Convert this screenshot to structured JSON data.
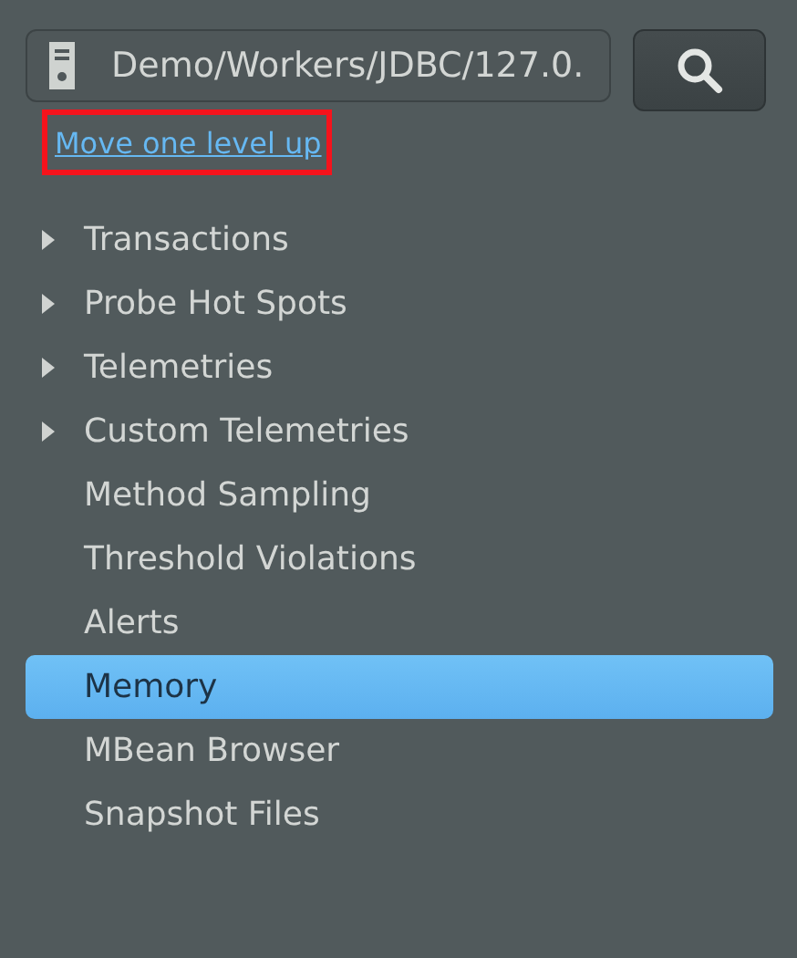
{
  "path_field": {
    "value": "Demo/Workers/JDBC/127.0."
  },
  "up_link": {
    "label": "Move one level up",
    "highlighted": true
  },
  "tree": [
    {
      "label": "Transactions",
      "kind": "branch",
      "expanded": false,
      "selected": false
    },
    {
      "label": "Probe Hot Spots",
      "kind": "branch",
      "expanded": false,
      "selected": false
    },
    {
      "label": "Telemetries",
      "kind": "branch",
      "expanded": false,
      "selected": false
    },
    {
      "label": "Custom Telemetries",
      "kind": "branch",
      "expanded": false,
      "selected": false
    },
    {
      "label": "Method Sampling",
      "kind": "leaf",
      "selected": false
    },
    {
      "label": "Threshold Violations",
      "kind": "leaf",
      "selected": false
    },
    {
      "label": "Alerts",
      "kind": "leaf",
      "selected": false
    },
    {
      "label": "Memory",
      "kind": "leaf",
      "selected": true
    },
    {
      "label": "MBean Browser",
      "kind": "leaf",
      "selected": false
    },
    {
      "label": "Snapshot Files",
      "kind": "leaf",
      "selected": false
    }
  ]
}
